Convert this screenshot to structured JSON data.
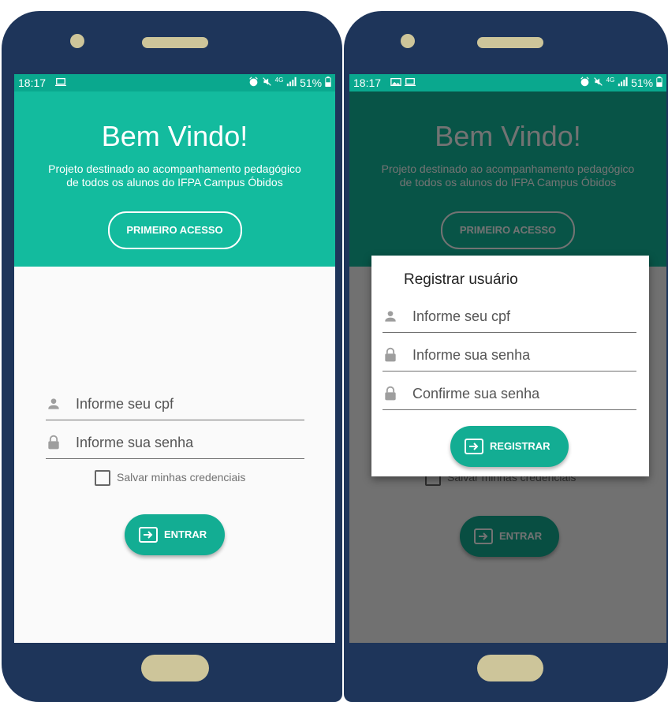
{
  "status_bar": {
    "time": "18:17",
    "battery": "51%",
    "network": "4G"
  },
  "login_screen": {
    "title": "Bem Vindo!",
    "description": "Projeto destinado ao acompanhamento pedagógico de todos os alunos do IFPA Campus Óbidos",
    "first_access_label": "PRIMEIRO ACESSO",
    "cpf_placeholder": "Informe seu cpf",
    "password_placeholder": "Informe sua senha",
    "remember_label": "Salvar minhas credenciais",
    "remember_checked": false,
    "login_label": "ENTRAR"
  },
  "register_dialog": {
    "title": "Registrar usuário",
    "cpf_placeholder": "Informe seu cpf",
    "password_placeholder": "Informe sua senha",
    "confirm_placeholder": "Confirme sua senha",
    "register_label": "REGISTRAR"
  },
  "colors": {
    "primary": "#13bb9e",
    "button": "#13ad93",
    "frame": "#1e355a",
    "accent_buttons": "#cdc59a"
  },
  "icons": [
    "person-icon",
    "lock-icon",
    "login-icon",
    "alarm-icon",
    "mute-icon",
    "signal-icon",
    "battery-icon",
    "laptop-icon",
    "image-icon"
  ]
}
